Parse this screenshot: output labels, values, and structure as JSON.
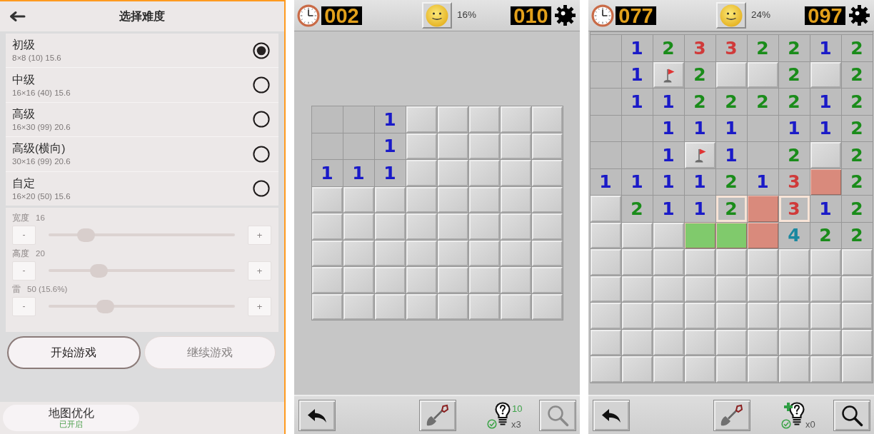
{
  "difficulty_screen": {
    "title": "选择难度",
    "levels": [
      {
        "name": "初级",
        "detail": "8×8 (10) 15.6",
        "selected": true
      },
      {
        "name": "中级",
        "detail": "16×16 (40) 15.6",
        "selected": false
      },
      {
        "name": "高级",
        "detail": "16×30 (99) 20.6",
        "selected": false
      },
      {
        "name": "高级(横向)",
        "detail": "30×16 (99) 20.6",
        "selected": false
      },
      {
        "name": "自定",
        "detail": "16×20 (50) 15.6",
        "selected": false
      }
    ],
    "sliders": [
      {
        "label": "宽度",
        "value": "16",
        "decrement": "-",
        "increment": "+",
        "level": 0.2
      },
      {
        "label": "高度",
        "value": "20",
        "decrement": "-",
        "increment": "+",
        "level": 0.27
      },
      {
        "label": "雷",
        "value": "50 (15.6%)",
        "decrement": "-",
        "increment": "+",
        "level": 0.305
      }
    ],
    "buttons": [
      {
        "label": "开始游戏",
        "disabled": false
      },
      {
        "label": "继续游戏",
        "disabled": true
      }
    ],
    "map_optimization": {
      "label": "地图优化",
      "status": "已开启"
    }
  },
  "games": [
    {
      "timer": "002",
      "progress": "16%",
      "mine_counter": "010",
      "board": {
        "scrolled": false,
        "rows": [
          [
            {
              "kind": "empty"
            },
            {
              "kind": "empty"
            },
            {
              "kind": "number",
              "text": "1",
              "color": "#1a1ac8"
            },
            {
              "kind": "hidden"
            },
            {
              "kind": "hidden"
            },
            {
              "kind": "hidden"
            },
            {
              "kind": "hidden"
            },
            {
              "kind": "hidden"
            }
          ],
          [
            {
              "kind": "empty"
            },
            {
              "kind": "empty"
            },
            {
              "kind": "number",
              "text": "1",
              "color": "#1a1ac8"
            },
            {
              "kind": "hidden"
            },
            {
              "kind": "hidden"
            },
            {
              "kind": "hidden"
            },
            {
              "kind": "hidden"
            },
            {
              "kind": "hidden"
            }
          ],
          [
            {
              "kind": "number",
              "text": "1",
              "color": "#1a1ac8"
            },
            {
              "kind": "number",
              "text": "1",
              "color": "#1a1ac8"
            },
            {
              "kind": "number",
              "text": "1",
              "color": "#1a1ac8"
            },
            {
              "kind": "hidden"
            },
            {
              "kind": "hidden"
            },
            {
              "kind": "hidden"
            },
            {
              "kind": "hidden"
            },
            {
              "kind": "hidden"
            }
          ],
          [
            {
              "kind": "hidden"
            },
            {
              "kind": "hidden"
            },
            {
              "kind": "hidden"
            },
            {
              "kind": "hidden"
            },
            {
              "kind": "hidden"
            },
            {
              "kind": "hidden"
            },
            {
              "kind": "hidden"
            },
            {
              "kind": "hidden"
            }
          ],
          [
            {
              "kind": "hidden"
            },
            {
              "kind": "hidden"
            },
            {
              "kind": "hidden"
            },
            {
              "kind": "hidden"
            },
            {
              "kind": "hidden"
            },
            {
              "kind": "hidden"
            },
            {
              "kind": "hidden"
            },
            {
              "kind": "hidden"
            }
          ],
          [
            {
              "kind": "hidden"
            },
            {
              "kind": "hidden"
            },
            {
              "kind": "hidden"
            },
            {
              "kind": "hidden"
            },
            {
              "kind": "hidden"
            },
            {
              "kind": "hidden"
            },
            {
              "kind": "hidden"
            },
            {
              "kind": "hidden"
            }
          ],
          [
            {
              "kind": "hidden"
            },
            {
              "kind": "hidden"
            },
            {
              "kind": "hidden"
            },
            {
              "kind": "hidden"
            },
            {
              "kind": "hidden"
            },
            {
              "kind": "hidden"
            },
            {
              "kind": "hidden"
            },
            {
              "kind": "hidden"
            }
          ],
          [
            {
              "kind": "hidden"
            },
            {
              "kind": "hidden"
            },
            {
              "kind": "hidden"
            },
            {
              "kind": "hidden"
            },
            {
              "kind": "hidden"
            },
            {
              "kind": "hidden"
            },
            {
              "kind": "hidden"
            },
            {
              "kind": "hidden"
            }
          ]
        ]
      },
      "toolbar": {
        "hint_count": "10",
        "hint_multiplier": "x3",
        "hint_plus": false,
        "search_disabled": true
      }
    },
    {
      "timer": "077",
      "progress": "24%",
      "mine_counter": "097",
      "board": {
        "scrolled": true,
        "rows": [
          [
            {
              "kind": "empty"
            },
            {
              "kind": "number",
              "text": "1",
              "color": "#1a1ac8"
            },
            {
              "kind": "number",
              "text": "2",
              "color": "#1a8c1a"
            },
            {
              "kind": "number",
              "text": "3",
              "color": "#d03a3a"
            },
            {
              "kind": "number",
              "text": "3",
              "color": "#d03a3a"
            },
            {
              "kind": "number",
              "text": "2",
              "color": "#1a8c1a"
            },
            {
              "kind": "number",
              "text": "2",
              "color": "#1a8c1a"
            },
            {
              "kind": "number",
              "text": "1",
              "color": "#1a1ac8"
            },
            {
              "kind": "number",
              "text": "2",
              "color": "#1a8c1a"
            }
          ],
          [
            {
              "kind": "empty"
            },
            {
              "kind": "number",
              "text": "1",
              "color": "#1a1ac8"
            },
            {
              "kind": "flag"
            },
            {
              "kind": "number",
              "text": "2",
              "color": "#1a8c1a"
            },
            {
              "kind": "hidden"
            },
            {
              "kind": "hidden"
            },
            {
              "kind": "number",
              "text": "2",
              "color": "#1a8c1a"
            },
            {
              "kind": "hidden"
            },
            {
              "kind": "number",
              "text": "2",
              "color": "#1a8c1a"
            }
          ],
          [
            {
              "kind": "empty"
            },
            {
              "kind": "number",
              "text": "1",
              "color": "#1a1ac8"
            },
            {
              "kind": "number",
              "text": "1",
              "color": "#1a1ac8"
            },
            {
              "kind": "number",
              "text": "2",
              "color": "#1a8c1a"
            },
            {
              "kind": "number",
              "text": "2",
              "color": "#1a8c1a"
            },
            {
              "kind": "number",
              "text": "2",
              "color": "#1a8c1a"
            },
            {
              "kind": "number",
              "text": "2",
              "color": "#1a8c1a"
            },
            {
              "kind": "number",
              "text": "1",
              "color": "#1a1ac8"
            },
            {
              "kind": "number",
              "text": "2",
              "color": "#1a8c1a"
            }
          ],
          [
            {
              "kind": "empty"
            },
            {
              "kind": "empty"
            },
            {
              "kind": "number",
              "text": "1",
              "color": "#1a1ac8"
            },
            {
              "kind": "number",
              "text": "1",
              "color": "#1a1ac8"
            },
            {
              "kind": "number",
              "text": "1",
              "color": "#1a1ac8"
            },
            {
              "kind": "empty"
            },
            {
              "kind": "number",
              "text": "1",
              "color": "#1a1ac8"
            },
            {
              "kind": "number",
              "text": "1",
              "color": "#1a1ac8"
            },
            {
              "kind": "number",
              "text": "2",
              "color": "#1a8c1a"
            }
          ],
          [
            {
              "kind": "empty"
            },
            {
              "kind": "empty"
            },
            {
              "kind": "number",
              "text": "1",
              "color": "#1a1ac8"
            },
            {
              "kind": "flag"
            },
            {
              "kind": "number",
              "text": "1",
              "color": "#1a1ac8"
            },
            {
              "kind": "empty"
            },
            {
              "kind": "number",
              "text": "2",
              "color": "#1a8c1a"
            },
            {
              "kind": "hidden"
            },
            {
              "kind": "number",
              "text": "2",
              "color": "#1a8c1a"
            }
          ],
          [
            {
              "kind": "number",
              "text": "1",
              "color": "#1a1ac8"
            },
            {
              "kind": "number",
              "text": "1",
              "color": "#1a1ac8"
            },
            {
              "kind": "number",
              "text": "1",
              "color": "#1a1ac8"
            },
            {
              "kind": "number",
              "text": "1",
              "color": "#1a1ac8"
            },
            {
              "kind": "number",
              "text": "2",
              "color": "#1a8c1a"
            },
            {
              "kind": "number",
              "text": "1",
              "color": "#1a1ac8"
            },
            {
              "kind": "number",
              "text": "3",
              "color": "#d03a3a"
            },
            {
              "kind": "tinted",
              "color": "#d98a7c"
            },
            {
              "kind": "number",
              "text": "2",
              "color": "#1a8c1a"
            }
          ],
          [
            {
              "kind": "hidden"
            },
            {
              "kind": "number",
              "text": "2",
              "color": "#1a8c1a"
            },
            {
              "kind": "number",
              "text": "1",
              "color": "#1a1ac8"
            },
            {
              "kind": "number",
              "text": "1",
              "color": "#1a1ac8"
            },
            {
              "kind": "outlined",
              "text": "2",
              "color": "#1a8c1a"
            },
            {
              "kind": "tinted",
              "color": "#d98a7c"
            },
            {
              "kind": "outlined",
              "text": "3",
              "color": "#d03a3a"
            },
            {
              "kind": "number",
              "text": "1",
              "color": "#1a1ac8"
            },
            {
              "kind": "number",
              "text": "2",
              "color": "#1a8c1a"
            }
          ],
          [
            {
              "kind": "hidden"
            },
            {
              "kind": "hidden"
            },
            {
              "kind": "hidden"
            },
            {
              "kind": "tinted",
              "color": "#80ca6c"
            },
            {
              "kind": "tinted",
              "color": "#80ca6c"
            },
            {
              "kind": "tinted",
              "color": "#d98a7c"
            },
            {
              "kind": "number",
              "text": "4",
              "color": "#1a88a0"
            },
            {
              "kind": "number",
              "text": "2",
              "color": "#1a8c1a"
            },
            {
              "kind": "number",
              "text": "2",
              "color": "#1a8c1a"
            }
          ],
          [
            {
              "kind": "hidden"
            },
            {
              "kind": "hidden"
            },
            {
              "kind": "hidden"
            },
            {
              "kind": "hidden"
            },
            {
              "kind": "hidden"
            },
            {
              "kind": "hidden"
            },
            {
              "kind": "hidden"
            },
            {
              "kind": "hidden"
            },
            {
              "kind": "hidden"
            }
          ],
          [
            {
              "kind": "hidden"
            },
            {
              "kind": "hidden"
            },
            {
              "kind": "hidden"
            },
            {
              "kind": "hidden"
            },
            {
              "kind": "hidden"
            },
            {
              "kind": "hidden"
            },
            {
              "kind": "hidden"
            },
            {
              "kind": "hidden"
            },
            {
              "kind": "hidden"
            }
          ],
          [
            {
              "kind": "hidden"
            },
            {
              "kind": "hidden"
            },
            {
              "kind": "hidden"
            },
            {
              "kind": "hidden"
            },
            {
              "kind": "hidden"
            },
            {
              "kind": "hidden"
            },
            {
              "kind": "hidden"
            },
            {
              "kind": "hidden"
            },
            {
              "kind": "hidden"
            }
          ],
          [
            {
              "kind": "hidden"
            },
            {
              "kind": "hidden"
            },
            {
              "kind": "hidden"
            },
            {
              "kind": "hidden"
            },
            {
              "kind": "hidden"
            },
            {
              "kind": "hidden"
            },
            {
              "kind": "hidden"
            },
            {
              "kind": "hidden"
            },
            {
              "kind": "hidden"
            }
          ],
          [
            {
              "kind": "hidden"
            },
            {
              "kind": "hidden"
            },
            {
              "kind": "hidden"
            },
            {
              "kind": "hidden"
            },
            {
              "kind": "hidden"
            },
            {
              "kind": "hidden"
            },
            {
              "kind": "hidden"
            },
            {
              "kind": "hidden"
            },
            {
              "kind": "hidden"
            }
          ]
        ]
      },
      "toolbar": {
        "hint_multiplier": "x0",
        "hint_plus": true,
        "search_disabled": false
      }
    }
  ]
}
